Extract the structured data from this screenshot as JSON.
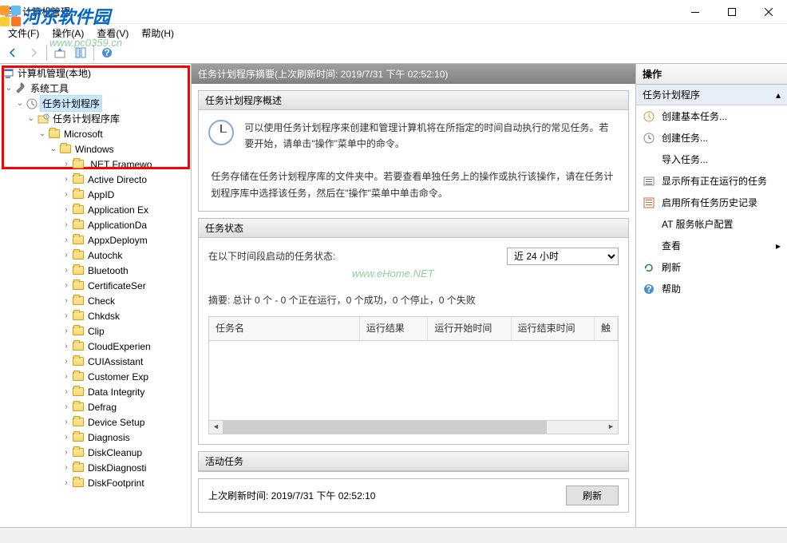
{
  "window": {
    "title": "计算机管理"
  },
  "menu": {
    "file": "文件(F)",
    "action": "操作(A)",
    "view": "查看(V)",
    "help": "帮助(H)"
  },
  "tree": {
    "root": "计算机管理(本地)",
    "system_tools": "系统工具",
    "task_scheduler": "任务计划程序",
    "task_library": "任务计划程序库",
    "microsoft": "Microsoft",
    "windows": "Windows",
    "folders": [
      ".NET Framewo",
      "Active Directo",
      "AppID",
      "Application Ex",
      "ApplicationDa",
      "AppxDeploym",
      "Autochk",
      "Bluetooth",
      "CertificateSer",
      "Check",
      "Chkdsk",
      "Clip",
      "CloudExperien",
      "CUIAssistant",
      "Customer Exp",
      "Data Integrity",
      "Defrag",
      "Device Setup",
      "Diagnosis",
      "DiskCleanup",
      "DiskDiagnosti",
      "DiskFootprint"
    ]
  },
  "content": {
    "header": "任务计划程序摘要(上次刷新时间: 2019/7/31 下午 02:52:10)",
    "overview_title": "任务计划程序概述",
    "overview_p1": "可以使用任务计划程序来创建和管理计算机将在所指定的时间自动执行的常见任务。若要开始，请单击\"操作\"菜单中的命令。",
    "overview_p2": "任务存储在任务计划程序库的文件夹中。若要查看单独任务上的操作或执行该操作，请在任务计划程序库中选择该任务，然后在\"操作\"菜单中单击命令。",
    "status_title": "任务状态",
    "status_label": "在以下时间段启动的任务状态:",
    "status_select": "近 24 小时",
    "status_summary": "摘要: 总计 0 个 - 0 个正在运行，0 个成功，0 个停止，0 个失败",
    "table_cols": {
      "name": "任务名",
      "result": "运行结果",
      "start": "运行开始时间",
      "end": "运行结束时间",
      "trigger": "触"
    },
    "active_title": "活动任务",
    "refresh_time": "上次刷新时间: 2019/7/31 下午 02:52:10",
    "refresh_btn": "刷新"
  },
  "actions": {
    "header": "操作",
    "subhead": "任务计划程序",
    "items": {
      "create_basic": "创建基本任务...",
      "create": "创建任务...",
      "import": "导入任务...",
      "show_running": "显示所有正在运行的任务",
      "enable_history": "启用所有任务历史记录",
      "at_service": "AT 服务帐户配置",
      "view": "查看",
      "refresh": "刷新",
      "help": "帮助"
    }
  },
  "watermarks": {
    "brand": "河东软件园",
    "url": "www.pc0359.cn",
    "center": "www.eHome.NET"
  }
}
